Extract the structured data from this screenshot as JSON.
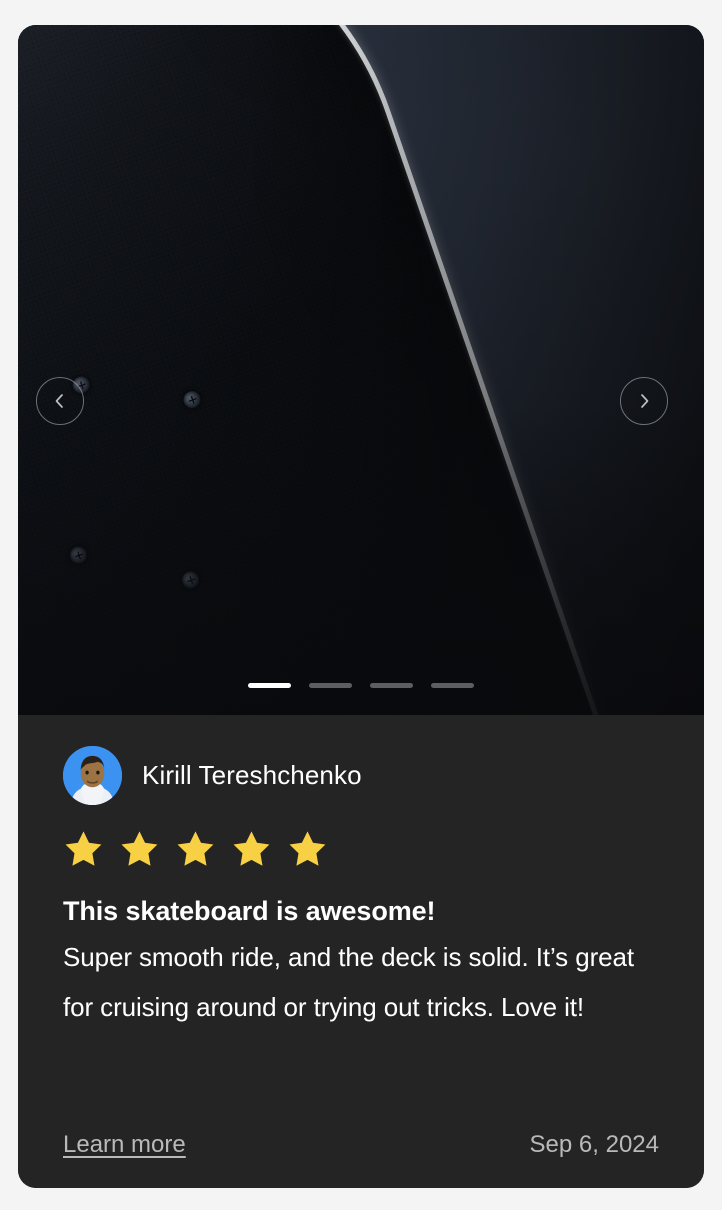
{
  "card": {
    "media": {
      "image_alt": "skateboard-deck-photo",
      "nav": {
        "prev_label": "Previous image",
        "next_label": "Next image"
      },
      "carousel": {
        "total": 4,
        "active_index": 0
      }
    },
    "review": {
      "author": "Kirill Tereshchenko",
      "avatar_name": "user-avatar",
      "rating": 5,
      "rating_max": 5,
      "title": "This skateboard is awesome!",
      "body": "Super smooth ride, and the deck is solid. It’s great for cruising around or trying out tricks. Love it!",
      "learn_more_label": "Learn more",
      "date": "Sep 6, 2024"
    }
  },
  "colors": {
    "page_background": "#f4f4f4",
    "card_background": "#242424",
    "star_fill": "#f5d games",
    "star": "#f7d044",
    "text_primary": "#ffffff",
    "text_muted": "#b9b9b9",
    "avatar_background": "#3b92f0",
    "indicator_active": "#ffffff",
    "indicator_inactive": "#a0a4aa"
  }
}
